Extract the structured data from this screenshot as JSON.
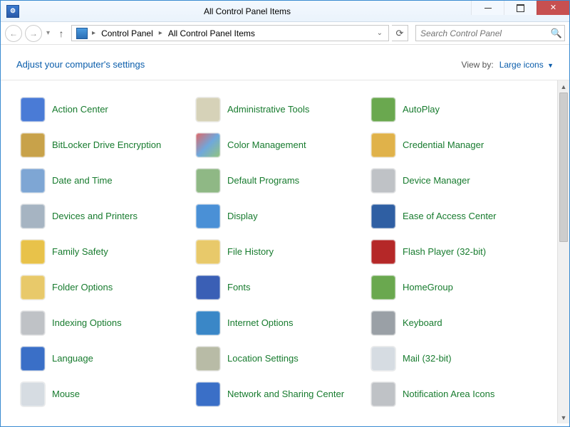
{
  "window": {
    "title": "All Control Panel Items"
  },
  "breadcrumb": {
    "root": "Control Panel",
    "current": "All Control Panel Items"
  },
  "search": {
    "placeholder": "Search Control Panel"
  },
  "header": {
    "title": "Adjust your computer's settings",
    "view_by_label": "View by:",
    "view_by_value": "Large icons"
  },
  "items": [
    {
      "label": "Action Center",
      "icon_name": "flag-icon",
      "icon_bg": "#4a7bd6"
    },
    {
      "label": "Administrative Tools",
      "icon_name": "tools-icon",
      "icon_bg": "#d6d2b8"
    },
    {
      "label": "AutoPlay",
      "icon_name": "autoplay-icon",
      "icon_bg": "#6aa84f"
    },
    {
      "label": "BitLocker Drive Encryption",
      "icon_name": "lock-icon",
      "icon_bg": "#c8a24a"
    },
    {
      "label": "Color Management",
      "icon_name": "color-icon",
      "icon_bg": "linear-gradient(135deg,#e06666,#6fa8dc,#93c47d)"
    },
    {
      "label": "Credential Manager",
      "icon_name": "vault-icon",
      "icon_bg": "#e0b24a"
    },
    {
      "label": "Date and Time",
      "icon_name": "clock-icon",
      "icon_bg": "#7ea6d4"
    },
    {
      "label": "Default Programs",
      "icon_name": "defaults-icon",
      "icon_bg": "#8fb885"
    },
    {
      "label": "Device Manager",
      "icon_name": "device-icon",
      "icon_bg": "#bfc2c6"
    },
    {
      "label": "Devices and Printers",
      "icon_name": "printer-icon",
      "icon_bg": "#a6b4c2"
    },
    {
      "label": "Display",
      "icon_name": "display-icon",
      "icon_bg": "#4a90d6"
    },
    {
      "label": "Ease of Access Center",
      "icon_name": "ease-icon",
      "icon_bg": "#2f5fa3"
    },
    {
      "label": "Family Safety",
      "icon_name": "family-icon",
      "icon_bg": "#e8c24a"
    },
    {
      "label": "File History",
      "icon_name": "history-icon",
      "icon_bg": "#e8c96a"
    },
    {
      "label": "Flash Player (32-bit)",
      "icon_name": "flash-icon",
      "icon_bg": "#b52828"
    },
    {
      "label": "Folder Options",
      "icon_name": "folder-icon",
      "icon_bg": "#e8c96a"
    },
    {
      "label": "Fonts",
      "icon_name": "fonts-icon",
      "icon_bg": "#3a5fb5"
    },
    {
      "label": "HomeGroup",
      "icon_name": "homegroup-icon",
      "icon_bg": "#6aa84f"
    },
    {
      "label": "Indexing Options",
      "icon_name": "indexing-icon",
      "icon_bg": "#bfc2c6"
    },
    {
      "label": "Internet Options",
      "icon_name": "internet-icon",
      "icon_bg": "#3a87c7"
    },
    {
      "label": "Keyboard",
      "icon_name": "keyboard-icon",
      "icon_bg": "#9aa0a6"
    },
    {
      "label": "Language",
      "icon_name": "language-icon",
      "icon_bg": "#3a6fc7"
    },
    {
      "label": "Location Settings",
      "icon_name": "location-icon",
      "icon_bg": "#b8bba6"
    },
    {
      "label": "Mail (32-bit)",
      "icon_name": "mail-icon",
      "icon_bg": "#d6dce2"
    },
    {
      "label": "Mouse",
      "icon_name": "mouse-icon",
      "icon_bg": "#d6dce2"
    },
    {
      "label": "Network and Sharing Center",
      "icon_name": "network-icon",
      "icon_bg": "#3a6fc7"
    },
    {
      "label": "Notification Area Icons",
      "icon_name": "tray-icon",
      "icon_bg": "#bfc2c6"
    }
  ]
}
